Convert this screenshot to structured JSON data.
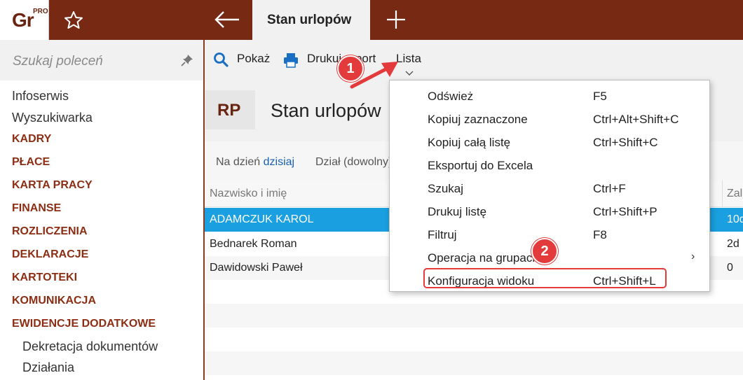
{
  "app": {
    "logo_text": "Gr",
    "logo_badge": "PRO",
    "active_tab": "Stan urlopów"
  },
  "sidebar": {
    "search_placeholder": "Szukaj poleceń",
    "items": [
      {
        "label": "Infoserwis",
        "kind": "plain"
      },
      {
        "label": "Wyszukiwarka",
        "kind": "plain"
      },
      {
        "label": "KADRY",
        "kind": "section"
      },
      {
        "label": "PŁACE",
        "kind": "section"
      },
      {
        "label": "KARTA PRACY",
        "kind": "section"
      },
      {
        "label": "FINANSE",
        "kind": "section"
      },
      {
        "label": "ROZLICZENIA",
        "kind": "section"
      },
      {
        "label": "DEKLARACJE",
        "kind": "section"
      },
      {
        "label": "KARTOTEKI",
        "kind": "section"
      },
      {
        "label": "KOMUNIKACJA",
        "kind": "section"
      },
      {
        "label": "EWIDENCJE DODATKOWE",
        "kind": "section"
      },
      {
        "label": "Dekretacja dokumentów",
        "kind": "sub"
      },
      {
        "label": "Działania",
        "kind": "sub"
      }
    ]
  },
  "toolbar": {
    "show_label": "Pokaż",
    "print_label": "Drukuj raport",
    "list_label": "Lista"
  },
  "page": {
    "badge": "RP",
    "title": "Stan urlopów"
  },
  "filters": {
    "date_prefix": "Na dzień",
    "date_value": "dzisiaj",
    "department": "Dział (dowolny)"
  },
  "grid": {
    "headers": [
      "Nazwisko i imię",
      "Zal"
    ],
    "rows": [
      {
        "name": "ADAMCZUK KAROL",
        "value": "10d",
        "selected": true
      },
      {
        "name": "Bednarek Roman",
        "value": "2d",
        "selected": false
      },
      {
        "name": "Dawidowski Paweł",
        "value": "0",
        "selected": false
      }
    ]
  },
  "menu": {
    "items": [
      {
        "label": "Odśwież",
        "shortcut": "F5"
      },
      {
        "label": "Kopiuj zaznaczone",
        "shortcut": "Ctrl+Alt+Shift+C"
      },
      {
        "label": "Kopiuj całą listę",
        "shortcut": "Ctrl+Shift+C"
      },
      {
        "label": "Eksportuj do Excela",
        "shortcut": ""
      },
      {
        "label": "Szukaj",
        "shortcut": "Ctrl+F"
      },
      {
        "label": "Drukuj listę",
        "shortcut": "Ctrl+Shift+P"
      },
      {
        "label": "Filtruj",
        "shortcut": "F8"
      },
      {
        "label": "Operacja na grupach",
        "shortcut": "",
        "submenu": "›"
      },
      {
        "label": "Konfiguracja widoku",
        "shortcut": "Ctrl+Shift+L"
      }
    ]
  },
  "callouts": {
    "step1": "1",
    "step2": "2"
  },
  "colors": {
    "brand": "#772914",
    "section_text": "#8c2e14",
    "selection": "#1a9fe0",
    "callout": "#e33b3b"
  }
}
